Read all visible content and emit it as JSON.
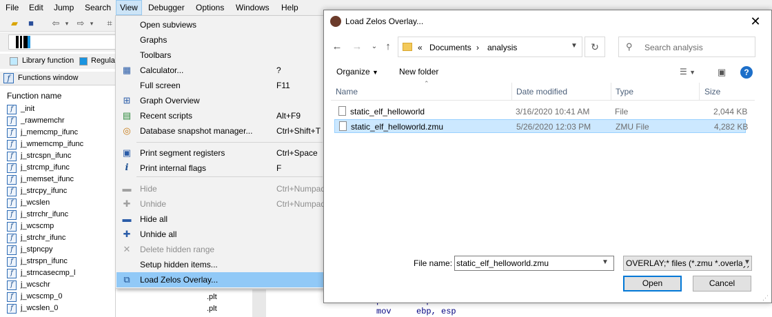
{
  "menubar": {
    "items": [
      "File",
      "Edit",
      "Jump",
      "Search",
      "View",
      "Debugger",
      "Options",
      "Windows",
      "Help"
    ]
  },
  "legend": {
    "library_label": "Library function",
    "regular_label": "Regular",
    "library_color": "#c0eaff",
    "regular_color": "#1a94e0"
  },
  "functions_window": {
    "title": "Functions window",
    "column_header": "Function name",
    "functions": [
      "_init",
      "_rawmemchr",
      "j_memcmp_ifunc",
      "j_wmemcmp_ifunc",
      "j_strcspn_ifunc",
      "j_strcmp_ifunc",
      "j_memset_ifunc",
      "j_strcpy_ifunc",
      "j_wcslen",
      "j_strrchr_ifunc",
      "j_wcscmp",
      "j_strchr_ifunc",
      "j_stpncpy",
      "j_strspn_ifunc",
      "j_strncasecmp_l",
      "j_wcschr",
      "j_wcscmp_0",
      "j_wcslen_0"
    ]
  },
  "segments": [
    ".plt",
    ".plt"
  ],
  "disassembly": {
    "lines": [
      {
        "mnemonic": "push",
        "operands": "ebp"
      },
      {
        "mnemonic": "mov",
        "operands": "ebp, esp"
      }
    ]
  },
  "view_menu": {
    "items": [
      {
        "label": "Open subviews",
        "shortcut": "",
        "icon": "",
        "disabled": false
      },
      {
        "label": "Graphs",
        "shortcut": "",
        "icon": "",
        "disabled": false
      },
      {
        "label": "Toolbars",
        "shortcut": "",
        "icon": "",
        "disabled": false
      },
      {
        "label": "Calculator...",
        "shortcut": "?",
        "icon": "calculator-icon",
        "disabled": false
      },
      {
        "label": "Full screen",
        "shortcut": "F11",
        "icon": "",
        "disabled": false
      },
      {
        "label": "Graph Overview",
        "shortcut": "",
        "icon": "graph-overview-icon",
        "disabled": false
      },
      {
        "label": "Recent scripts",
        "shortcut": "Alt+F9",
        "icon": "recent-scripts-icon",
        "disabled": false
      },
      {
        "label": "Database snapshot manager...",
        "shortcut": "Ctrl+Shift+T",
        "icon": "snapshot-icon",
        "disabled": false
      },
      {
        "label": "Print segment registers",
        "shortcut": "Ctrl+Space",
        "icon": "segment-registers-icon",
        "disabled": false
      },
      {
        "label": "Print internal flags",
        "shortcut": "F",
        "icon": "info-icon",
        "disabled": false
      },
      {
        "label": "Hide",
        "shortcut": "Ctrl+Numpad-",
        "icon": "minus-icon",
        "disabled": true
      },
      {
        "label": "Unhide",
        "shortcut": "Ctrl+Numpad+",
        "icon": "plus-icon",
        "disabled": true
      },
      {
        "label": "Hide all",
        "shortcut": "",
        "icon": "minus-icon",
        "disabled": false
      },
      {
        "label": "Unhide all",
        "shortcut": "",
        "icon": "plus-icon",
        "disabled": false
      },
      {
        "label": "Delete hidden range",
        "shortcut": "",
        "icon": "delete-icon",
        "disabled": true
      },
      {
        "label": "Setup hidden items...",
        "shortcut": "",
        "icon": "",
        "disabled": false
      },
      {
        "label": "Load Zelos Overlay...",
        "shortcut": "",
        "icon": "overlay-icon",
        "disabled": false,
        "highlighted": true
      }
    ]
  },
  "dialog": {
    "title": "Load Zelos Overlay...",
    "breadcrumb": [
      "«",
      "Documents",
      "›",
      "analysis"
    ],
    "search_placeholder": "Search analysis",
    "organize_label": "Organize",
    "new_folder_label": "New folder",
    "columns": [
      "Name",
      "Date modified",
      "Type",
      "Size"
    ],
    "files": [
      {
        "name": "static_elf_helloworld",
        "date": "3/16/2020 10:41 AM",
        "type": "File",
        "size": "2,044 KB",
        "selected": false
      },
      {
        "name": "static_elf_helloworld.zmu",
        "date": "5/26/2020 12:03 PM",
        "type": "ZMU File",
        "size": "4,282 KB",
        "selected": true
      }
    ],
    "file_name_label": "File name:",
    "file_name_value": "static_elf_helloworld.zmu",
    "file_type_value": "OVERLAY;* files (*.zmu *.overlay)",
    "open_label": "Open",
    "cancel_label": "Cancel"
  }
}
